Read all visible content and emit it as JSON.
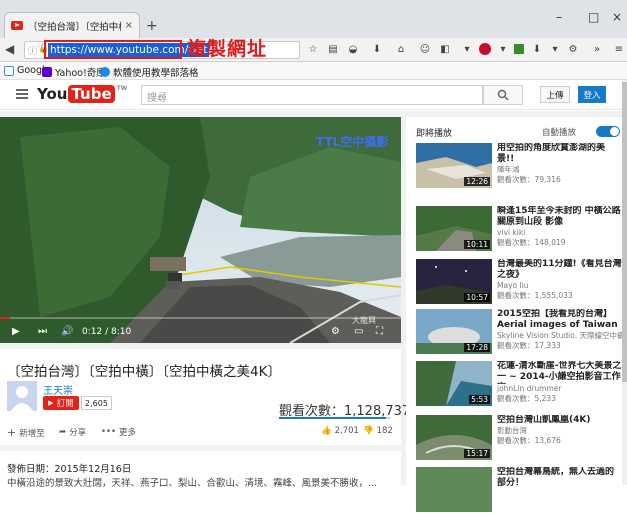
{
  "browser": {
    "tab_title": "〔空拍台灣〕〔空拍中橫...",
    "tab_close": "×",
    "new_tab": "+",
    "url": "https://www.youtube.com/wat",
    "annotation": "複製網址",
    "window_controls": [
      "–",
      "□",
      "×"
    ],
    "bookmarks": [
      {
        "label": "Google",
        "color": "#4285f4"
      },
      {
        "label": "Yahoo!奇摩",
        "color": "#5f01d1"
      },
      {
        "label": "軟體使用教學部落格",
        "color": "#1e88e5"
      }
    ]
  },
  "youtube": {
    "logo_you": "You",
    "logo_tube": "Tube",
    "logo_tw": "TW",
    "search_placeholder": "搜尋",
    "upload": "上傳",
    "signin": "登入"
  },
  "player": {
    "watermark": "TTL空中攝影",
    "corner_text": "大龍興",
    "time": "0:12 / 8:10",
    "progress": 0.0245
  },
  "video_info": {
    "title": "〔空拍台灣〕〔空拍中橫〕〔空拍中橫之美4K〕",
    "channel": "王天崇",
    "subscribe": "訂閱",
    "subscriber_count": "2,605",
    "views": "觀看次數：1,128,737",
    "like_ratio": 0.96,
    "add_to": "新增至",
    "share": "分享",
    "more": "更多",
    "likes": "2,701",
    "dislikes": "182"
  },
  "description": {
    "published": "發佈日期：2015年12月16日",
    "line2": "中橫沿途的景致大壯闊，天祥、燕子口、梨山、合歡山、清境、霧峰、風景美不勝收，..."
  },
  "sidebar": {
    "up_next": "即將播放",
    "autoplay": "自動播放",
    "items": [
      {
        "title": "用空拍的角度欣賞澎湖的美景!!",
        "channel": "陳年鴻",
        "views": "觀看次數：79,316",
        "duration": "12:26"
      },
      {
        "title": "瞬逢15年至今未封的 中橫公路關原到山段 影像",
        "channel": "vivi kiki",
        "views": "觀看次數：148,019",
        "duration": "10:11"
      },
      {
        "title": "台灣最美的11分鐘!《看見台灣之夜》",
        "channel": "Mayo liu",
        "views": "觀看次數：1,555,033",
        "duration": "10:57"
      },
      {
        "title": "2015空拍【我看見的台灣】 Aerial images of Taiwan",
        "channel": "Skyline Vision Studio. 天際線空中攝影",
        "views": "觀看次數：17,333",
        "duration": "17:28"
      },
      {
        "title": "花蓮-清水斷崖-世界七大美景之一 ~ 2014-小謙空拍影音工作室",
        "channel": "johnLin drummer",
        "views": "觀看次數：5,233",
        "duration": "5:53"
      },
      {
        "title": "空拍台灣山凱鳳凰(4K)",
        "channel": "影動台灣",
        "views": "觀看次數：13,676",
        "duration": "15:17"
      },
      {
        "title": "空拍台灣幕鳥統，無人去過的部分！",
        "channel": "",
        "views": "",
        "duration": ""
      }
    ]
  }
}
